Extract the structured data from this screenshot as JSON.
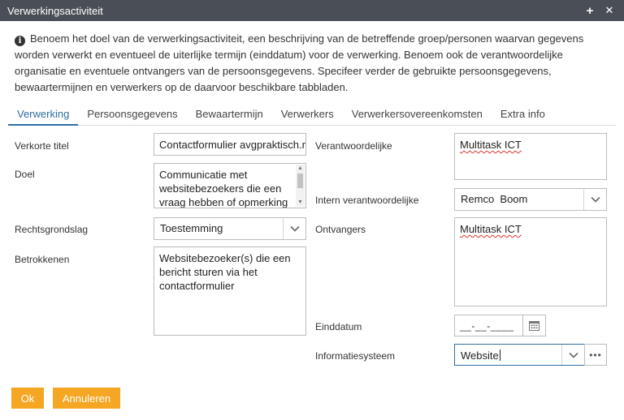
{
  "window": {
    "title": "Verwerkingsactiviteit",
    "add_glyph": "+",
    "close_glyph": "✕"
  },
  "info": {
    "icon": "info-icon",
    "text": "Benoem het doel van de verwerkingsactiviteit, een beschrijving van de betreffende groep/personen waarvan gegevens worden verwerkt en eventueel de uiterlijke termijn (einddatum) voor de verwerking. Benoem ook de verantwoordelijke organisatie en eventuele ontvangers van de persoonsgegevens. Specifeer verder de gebruikte persoonsgegevens, bewaartermijnen en verwerkers op de daarvoor beschikbare tabbladen."
  },
  "tabs": [
    {
      "label": "Verwerking",
      "active": true
    },
    {
      "label": "Persoonsgegevens"
    },
    {
      "label": "Bewaartermijn"
    },
    {
      "label": "Verwerkers"
    },
    {
      "label": "Verwerkersovereenkomsten"
    },
    {
      "label": "Extra info"
    }
  ],
  "form": {
    "verkorte_titel": {
      "label": "Verkorte titel",
      "value": "Contactformulier avgpraktisch.r"
    },
    "doel": {
      "label": "Doel",
      "value": "Communicatie met websitebezoekers die een vraag hebben of opmerking"
    },
    "rechtsgrondslag": {
      "label": "Rechtsgrondslag",
      "value": "Toestemming"
    },
    "betrokkenen": {
      "label": "Betrokkenen",
      "value": "Websitebezoeker(s) die een bericht sturen via het contactformulier"
    },
    "verantwoordelijke": {
      "label": "Verantwoordelijke",
      "value": "Multitask ICT"
    },
    "intern_verantwoordelijke": {
      "label": "Intern verantwoordelijke",
      "value": "Remco  Boom"
    },
    "ontvangers": {
      "label": "Ontvangers",
      "value": "Multitask ICT"
    },
    "einddatum": {
      "label": "Einddatum",
      "placeholder": "__-__-____"
    },
    "informatiesysteem": {
      "label": "Informatiesysteem",
      "value": "Website"
    }
  },
  "buttons": {
    "ok": "Ok",
    "cancel": "Annuleren"
  },
  "colors": {
    "titlebar": "#4a4f57",
    "accent": "#f5a623",
    "tab_active": "#2e6da4"
  }
}
